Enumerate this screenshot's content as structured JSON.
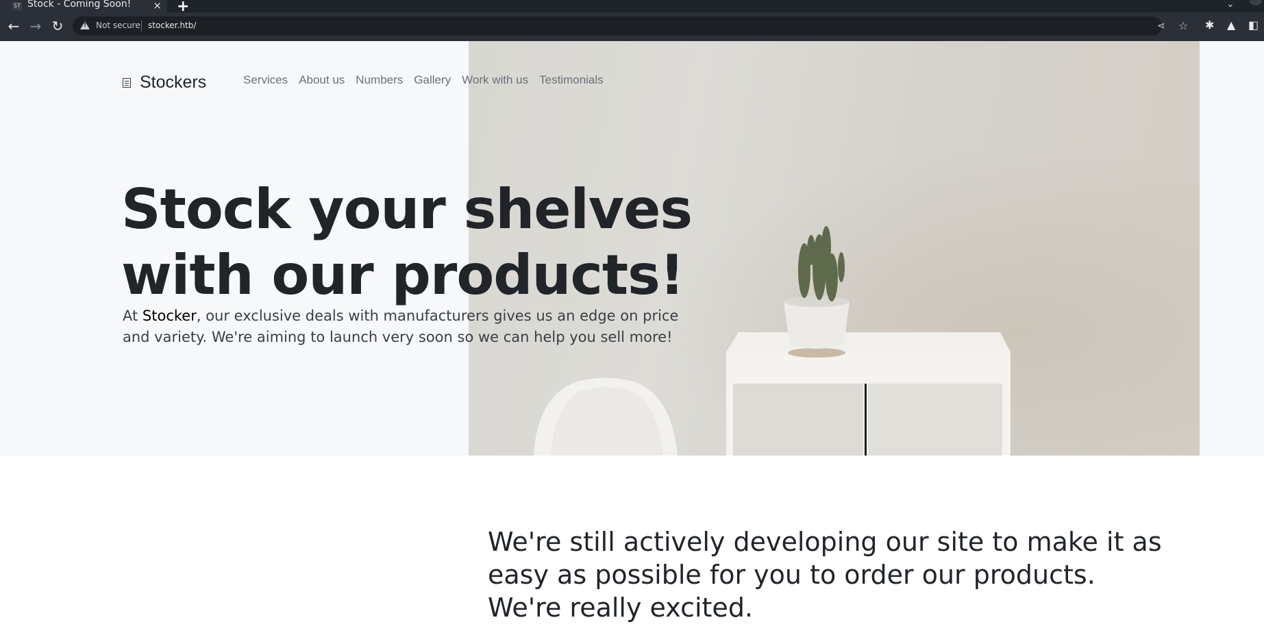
{
  "browser": {
    "tab_title": "Stock - Coming Soon!",
    "tab_favicon_text": "ST",
    "tab_close_glyph": "×",
    "new_tab_glyph": "+",
    "security_label": "Not secure",
    "url": "stocker.htb/",
    "icons": [
      "back-arrow-icon",
      "forward-arrow-icon",
      "reload-icon",
      "warning-icon",
      "share-icon",
      "star-icon",
      "extensions-icon",
      "labs-icon",
      "side-panel-icon",
      "tab-search-icon"
    ]
  },
  "site": {
    "brand": "Stockers",
    "nav": [
      "Services",
      "About us",
      "Numbers",
      "Gallery",
      "Work with us",
      "Testimonials"
    ]
  },
  "hero": {
    "title": "Stock your shelves with our products!",
    "text_prefix": "At ",
    "text_brand": "Stocker",
    "text_suffix": ", our exclusive deals with manufacturers gives us an edge on price and variety. We're aiming to launch very soon so we can help you sell more!",
    "image": "room-with-chair-cabinet-and-cactus-photo"
  },
  "section": {
    "lead": "We're still actively developing our site to make it as easy as possible for you to order our products. We're really excited."
  },
  "colors": {
    "hero_bg": "#f7f8fa",
    "heading": "#212529",
    "nav_text": "#6b6f75",
    "chrome_dark": "#1f232a",
    "chrome_toolbar": "#2b2f37"
  }
}
